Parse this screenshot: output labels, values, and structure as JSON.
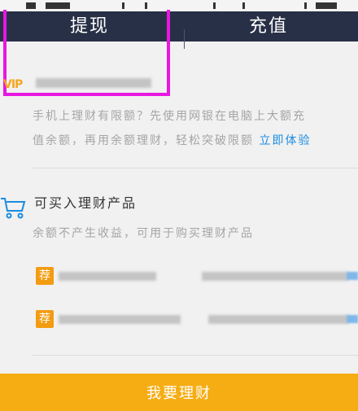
{
  "tabs": {
    "withdraw": "提现",
    "recharge": "充值"
  },
  "vip_label": "VIP",
  "notice": {
    "line1": "手机上理财有限额？先使用网银在电脑上大额充",
    "line2_prefix": "值余额，再用余额理财，轻松突破限额",
    "link": "立即体验"
  },
  "products": {
    "title": "可买入理财产品",
    "subtitle": "余额不产生收益，可用于购买理财产品",
    "badge": "荐"
  },
  "bottom_button": "我要理财",
  "colors": {
    "header_bg": "#283047",
    "accent_orange": "#f6ad14",
    "link_blue": "#1a8ce0",
    "highlight": "#e817e1"
  }
}
